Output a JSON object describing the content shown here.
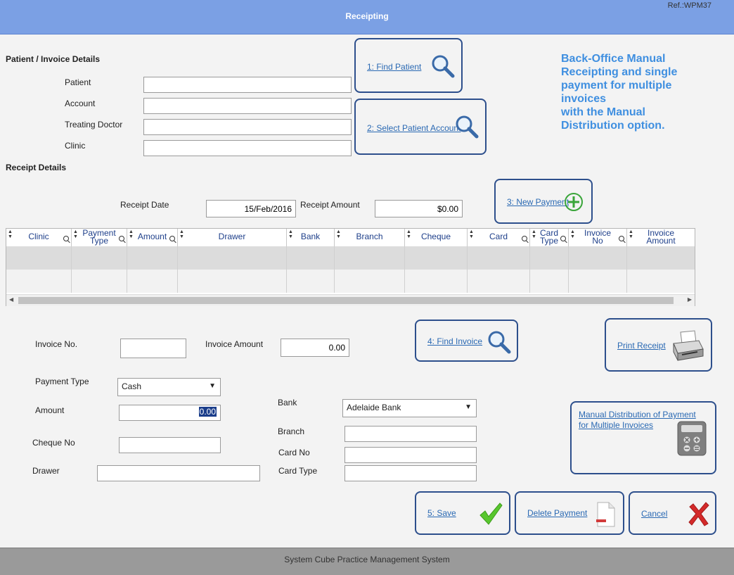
{
  "header": {
    "title": "Receipting",
    "ref": "Ref.:WPM37"
  },
  "patient_section": {
    "heading": "Patient / Invoice Details",
    "patient_label": "Patient",
    "account_label": "Account",
    "doctor_label": "Treating Doctor",
    "clinic_label": "Clinic",
    "patient_value": "",
    "account_value": "",
    "doctor_value": "",
    "clinic_value": ""
  },
  "buttons": {
    "find_patient": "1: Find Patient",
    "select_account": "2: Select Patient Account",
    "new_payment": "3: New Payment",
    "find_invoice": "4: Find Invoice",
    "print_receipt": "Print Receipt",
    "manual_distribution_line1": "Manual Distribution of Payment",
    "manual_distribution_line2": "for Multiple Invoices",
    "save": "5: Save",
    "delete_payment": "Delete Payment",
    "cancel": "Cancel"
  },
  "info": {
    "line1": "Back-Office Manual",
    "line2": "Receipting and single",
    "line3": "payment for multiple",
    "line4": "invoices",
    "line5": "with the Manual",
    "line6": "Distribution option."
  },
  "receipt_section": {
    "heading": "Receipt Details",
    "date_label": "Receipt Date",
    "date_value": "15/Feb/2016",
    "amount_label": "Receipt Amount",
    "amount_value": "$0.00"
  },
  "grid": {
    "columns": [
      {
        "line1": "Clinic",
        "line2": ""
      },
      {
        "line1": "Payment",
        "line2": "Type"
      },
      {
        "line1": "Amount",
        "line2": ""
      },
      {
        "line1": "Drawer",
        "line2": ""
      },
      {
        "line1": "Bank",
        "line2": ""
      },
      {
        "line1": "Branch",
        "line2": ""
      },
      {
        "line1": "Cheque",
        "line2": ""
      },
      {
        "line1": "Card",
        "line2": ""
      },
      {
        "line1": "Card",
        "line2": "Type"
      },
      {
        "line1": "Invoice",
        "line2": "No"
      },
      {
        "line1": "Invoice",
        "line2": "Amount"
      }
    ]
  },
  "invoice_section": {
    "invoice_no_label": "Invoice No.",
    "invoice_no_value": "",
    "invoice_amount_label": "Invoice Amount",
    "invoice_amount_value": "0.00",
    "payment_type_label": "Payment Type",
    "payment_type_value": "Cash",
    "amount_label": "Amount",
    "amount_value": "0.00",
    "cheque_no_label": "Cheque No",
    "cheque_no_value": "",
    "drawer_label": "Drawer",
    "drawer_value": "",
    "bank_label": "Bank",
    "bank_value": "Adelaide Bank",
    "branch_label": "Branch",
    "branch_value": "",
    "card_no_label": "Card No",
    "card_no_value": "",
    "card_type_label": "Card Type",
    "card_type_value": ""
  },
  "footer": {
    "text": "System Cube Practice Management System"
  },
  "colors": {
    "titlebar": "#7ba0e4",
    "button_border": "#2d4f8c",
    "link": "#2a69b3",
    "info_text": "#3f8fe0"
  },
  "icons": {
    "find": "magnifier-icon",
    "new": "plus-icon",
    "print": "printer-icon",
    "calc": "calculator-icon",
    "save": "checkmark-icon",
    "delete": "document-delete-icon",
    "cancel": "cross-icon"
  }
}
